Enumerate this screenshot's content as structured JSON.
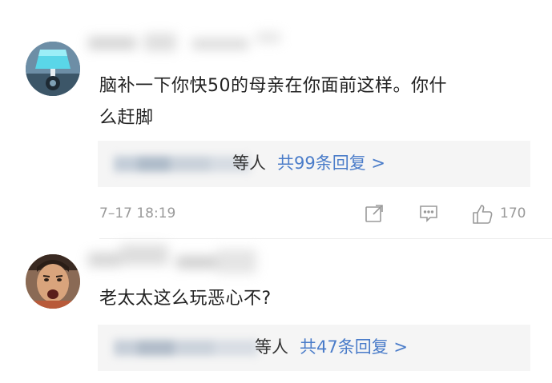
{
  "comments": [
    {
      "text_line1": "脑补一下你快50的母亲在你面前这样。你什",
      "text_line2": "么赶脚",
      "reply_suffix": "等人",
      "reply_link": "共99条回复 >",
      "timestamp": "7–17 18:19",
      "like_count": "170"
    },
    {
      "text_line1": "老太太这么玩恶心不?",
      "reply_suffix": "等人",
      "reply_link": "共47条回复 >"
    }
  ],
  "icons": {
    "share": "share-icon",
    "comment": "comment-icon",
    "like": "thumbs-up-icon"
  },
  "colors": {
    "link": "#4a7cc9",
    "meta": "#9a9a9a",
    "reply_bg": "#f5f5f5"
  }
}
